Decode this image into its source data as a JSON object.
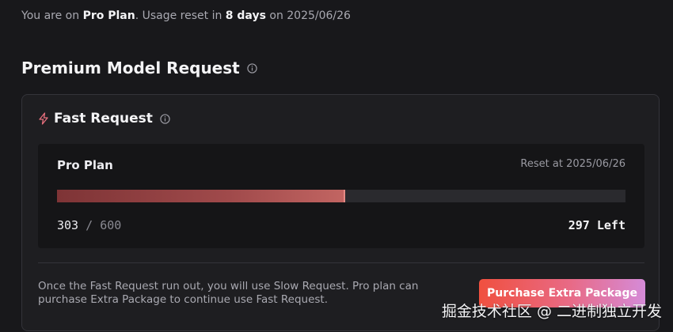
{
  "usage": {
    "prefix": "You are on ",
    "plan": "Pro Plan",
    "middle": ". Usage reset in ",
    "days": "8 days",
    "on_text": " on 2025/06/26"
  },
  "section": {
    "title": "Premium Model Request",
    "info_icon": "info-icon"
  },
  "fast_request": {
    "title": "Fast Request",
    "icon": "lightning-bolt-icon",
    "plan_name": "Pro Plan",
    "reset_at": "Reset at 2025/06/26",
    "used": "303",
    "separator": "/",
    "total": "600",
    "progress_fraction": 0.505,
    "left_text": "297 Left"
  },
  "footer": {
    "message": "Once the Fast Request run out, you will use Slow Request. Pro plan can purchase Extra Package to continue use Fast Request.",
    "purchase_label": "Purchase Extra Package"
  },
  "watermark": "掘金技术社区 @ 二进制独立开发",
  "colors": {
    "background": "#18181b",
    "card": "#1e1e21",
    "progress_fill": "#a04a4b",
    "button_gradient_start": "#f0503f",
    "button_gradient_end": "#d58bd8"
  }
}
